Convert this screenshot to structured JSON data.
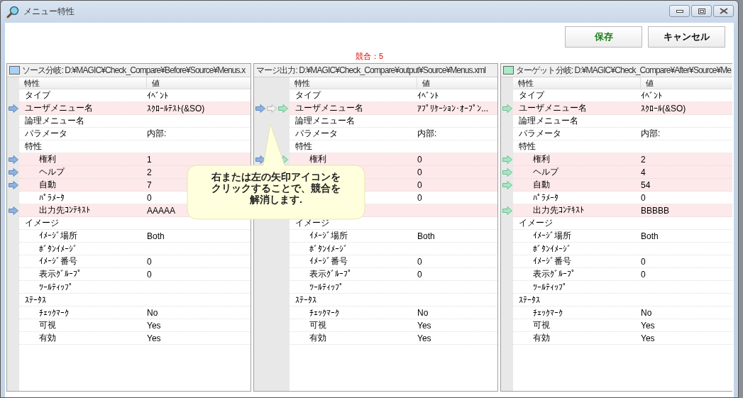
{
  "window": {
    "title": "メニュー特性"
  },
  "buttons": [
    {
      "label": "保存",
      "kind": "primary"
    },
    {
      "label": "キャンセル",
      "kind": "normal"
    }
  ],
  "conflict_count": "競合：5",
  "panels": [
    {
      "title": "ソース分岐: D:¥MAGIC¥Check_Compare¥Before¥Source¥Menus.x",
      "color": "#a9d1f5",
      "columns": [
        "特性",
        "値"
      ],
      "rows": [
        {
          "label": "タイプ",
          "value": "ｲﾍﾞﾝﾄ",
          "conflict": false
        },
        {
          "label": "ユーザメニュー名",
          "value": "ｽｸﾛｰﾙﾃｽﾄ(&SO)",
          "conflict": true,
          "arrows": [
            {
              "kind": "blue"
            }
          ]
        },
        {
          "label": "論理メニュー名",
          "conflict": false
        },
        {
          "label": "パラメータ",
          "value": "内部:",
          "conflict": false
        },
        {
          "label": "特性",
          "conflict": false,
          "children": [
            {
              "label": "権利",
              "value": "1",
              "conflict": true,
              "arrows": [
                {
                  "kind": "blue"
                }
              ]
            },
            {
              "label": "ヘルプ",
              "value": "2",
              "conflict": true,
              "arrows": [
                {
                  "kind": "blue"
                }
              ]
            },
            {
              "label": "自動",
              "value": "7",
              "conflict": true,
              "arrows": [
                {
                  "kind": "blue"
                }
              ]
            },
            {
              "label": "ﾊﾟﾗﾒｰﾀ",
              "value": "0",
              "conflict": false
            },
            {
              "label": "出力先ｺﾝﾃｷｽﾄ",
              "value": "AAAAA",
              "conflict": true,
              "arrows": [
                {
                  "kind": "blue"
                }
              ]
            }
          ]
        },
        {
          "label": "イメージ",
          "conflict": false,
          "children": [
            {
              "label": "ｲﾒｰｼﾞ場所",
              "value": "Both",
              "conflict": false
            },
            {
              "label": "ﾎﾞﾀﾝｲﾒｰｼﾞ",
              "conflict": false
            },
            {
              "label": "ｲﾒｰｼﾞ番号",
              "value": "0",
              "conflict": false
            },
            {
              "label": "表示ｸﾞﾙｰﾌﾟ",
              "value": "0",
              "conflict": false
            },
            {
              "label": "ﾂｰﾙﾃｨｯﾌﾟ",
              "conflict": false
            }
          ]
        },
        {
          "label": "ｽﾃｰﾀｽ",
          "conflict": false,
          "children": [
            {
              "label": "ﾁｪｯｸﾏｰｸ",
              "value": "No",
              "conflict": false
            },
            {
              "label": "可視",
              "value": "Yes",
              "conflict": false
            },
            {
              "label": "有効",
              "value": "Yes",
              "conflict": false
            }
          ]
        }
      ]
    },
    {
      "title": "マージ出力: D:¥MAGIC¥Check_Compare¥output¥Source¥Menus.xml",
      "columns": [
        "特性",
        "値"
      ],
      "rows": [
        {
          "label": "タイプ",
          "value": "ｲﾍﾞﾝﾄ",
          "conflict": false
        },
        {
          "label": "ユーザメニュー名",
          "value": "ｱﾌﾟﾘｹｰｼｮﾝ･ｵｰﾌﾟﾝ...",
          "conflict": true,
          "arrows": [
            {
              "kind": "blue"
            },
            {
              "kind": "gray"
            },
            {
              "kind": "green"
            }
          ]
        },
        {
          "label": "論理メニュー名",
          "conflict": false
        },
        {
          "label": "パラメータ",
          "value": "内部:",
          "conflict": false
        },
        {
          "label": "特性",
          "conflict": false,
          "children": [
            {
              "label": "権利",
              "value": "0",
              "conflict": true,
              "arrows": [
                {
                  "kind": "blue"
                },
                {
                  "kind": "green"
                }
              ]
            },
            {
              "value": "0",
              "conflict": true
            },
            {
              "value": "0",
              "conflict": true
            },
            {
              "value": "0",
              "conflict": false
            },
            {
              "conflict": true
            }
          ]
        },
        {
          "label": "イメージ",
          "conflict": false,
          "children": [
            {
              "label": "ｲﾒｰｼﾞ場所",
              "value": "Both",
              "conflict": false
            },
            {
              "label": "ﾎﾞﾀﾝｲﾒｰｼﾞ",
              "conflict": false
            },
            {
              "label": "ｲﾒｰｼﾞ番号",
              "value": "0",
              "conflict": false
            },
            {
              "label": "表示ｸﾞﾙｰﾌﾟ",
              "value": "0",
              "conflict": false
            },
            {
              "label": "ﾂｰﾙﾃｨｯﾌﾟ",
              "conflict": false
            }
          ]
        },
        {
          "label": "ｽﾃｰﾀｽ",
          "conflict": false,
          "children": [
            {
              "label": "ﾁｪｯｸﾏｰｸ",
              "value": "No",
              "conflict": false
            },
            {
              "label": "可視",
              "value": "Yes",
              "conflict": false
            },
            {
              "label": "有効",
              "value": "Yes",
              "conflict": false
            }
          ]
        }
      ]
    },
    {
      "title": "ターゲット分岐: D:¥MAGIC¥Check_Compare¥After¥Source¥Me",
      "color": "#a8ebc6",
      "columns": [
        "特性",
        "値"
      ],
      "rows": [
        {
          "label": "タイプ",
          "value": "ｲﾍﾞﾝﾄ",
          "conflict": false
        },
        {
          "label": "ユーザメニュー名",
          "value": "ｽｸﾛｰﾙ(&SO)",
          "conflict": true,
          "arrows": [
            {
              "kind": "green"
            }
          ]
        },
        {
          "label": "論理メニュー名",
          "conflict": false
        },
        {
          "label": "パラメータ",
          "value": "内部:",
          "conflict": false
        },
        {
          "label": "特性",
          "conflict": false,
          "children": [
            {
              "label": "権利",
              "value": "2",
              "conflict": true,
              "arrows": [
                {
                  "kind": "green"
                }
              ]
            },
            {
              "label": "ヘルプ",
              "value": "4",
              "conflict": true,
              "arrows": [
                {
                  "kind": "green"
                }
              ]
            },
            {
              "label": "自動",
              "value": "54",
              "conflict": true,
              "arrows": [
                {
                  "kind": "green"
                }
              ]
            },
            {
              "label": "ﾊﾟﾗﾒｰﾀ",
              "value": "0",
              "conflict": false
            },
            {
              "label": "出力先ｺﾝﾃｷｽﾄ",
              "value": "BBBBB",
              "conflict": true,
              "arrows": [
                {
                  "kind": "green"
                }
              ]
            }
          ]
        },
        {
          "label": "イメージ",
          "conflict": false,
          "children": [
            {
              "label": "ｲﾒｰｼﾞ場所",
              "value": "Both",
              "conflict": false
            },
            {
              "label": "ﾎﾞﾀﾝｲﾒｰｼﾞ",
              "conflict": false
            },
            {
              "label": "ｲﾒｰｼﾞ番号",
              "value": "0",
              "conflict": false
            },
            {
              "label": "表示ｸﾞﾙｰﾌﾟ",
              "value": "0",
              "conflict": false
            },
            {
              "label": "ﾂｰﾙﾃｨｯﾌﾟ",
              "conflict": false
            }
          ]
        },
        {
          "label": "ｽﾃｰﾀｽ",
          "conflict": false,
          "children": [
            {
              "label": "ﾁｪｯｸﾏｰｸ",
              "value": "No",
              "conflict": false
            },
            {
              "label": "可視",
              "value": "Yes",
              "conflict": false
            },
            {
              "label": "有効",
              "value": "Yes",
              "conflict": false
            }
          ]
        }
      ]
    }
  ],
  "tooltip": {
    "lines": [
      "右または左の矢印アイコンを",
      "クリックすることで、競合を",
      "解消します."
    ]
  }
}
